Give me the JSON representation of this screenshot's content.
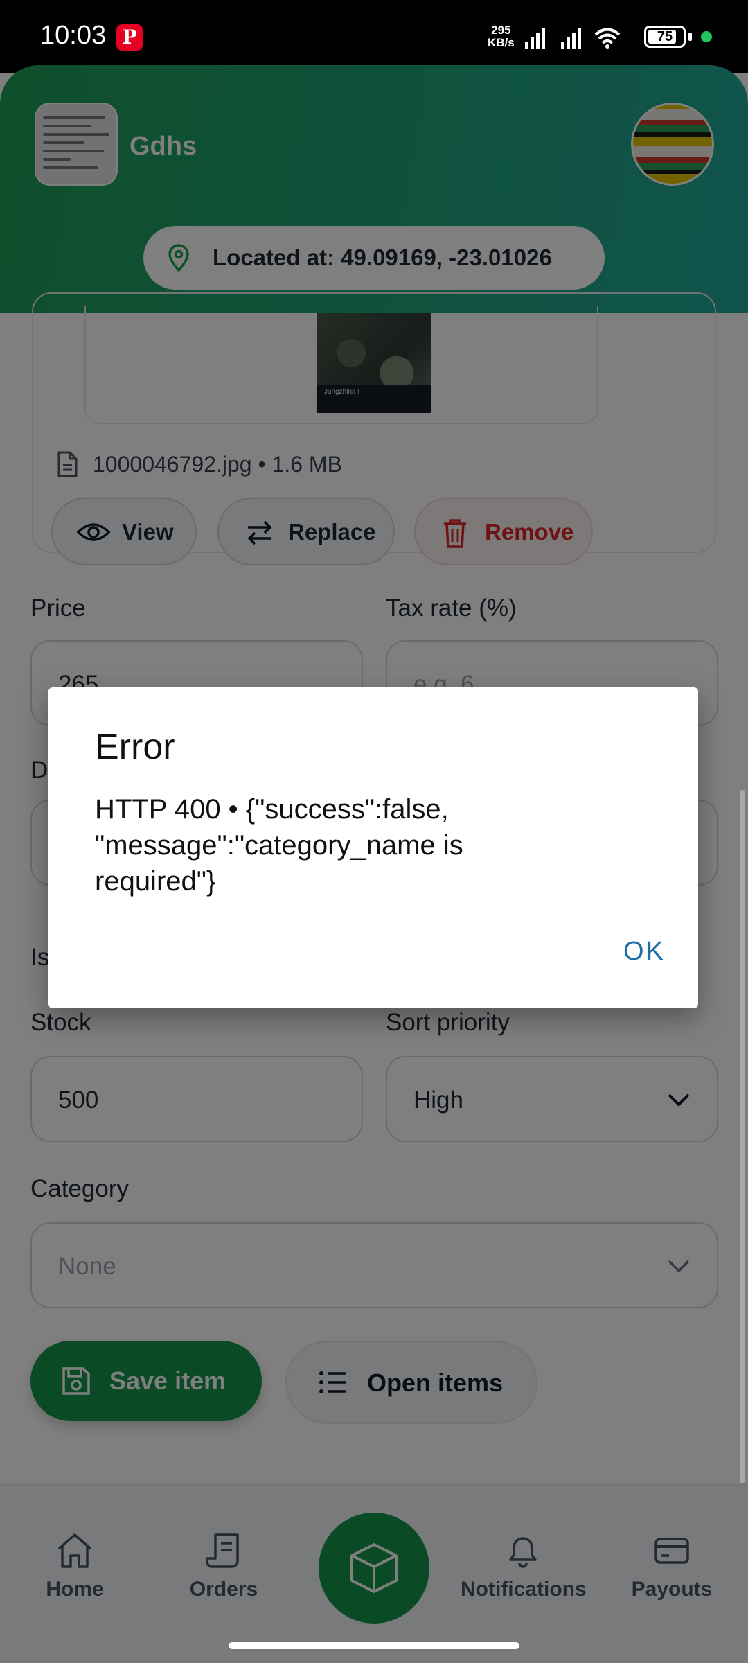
{
  "status_bar": {
    "time": "10:03",
    "pinterest_badge": "P",
    "net_speed_value": "295",
    "net_speed_unit": "KB/s",
    "battery": "75"
  },
  "header": {
    "store_name": "Gdhs",
    "location_text": "Located at: 49.09169, -23.01026"
  },
  "image_panel": {
    "map_caption": "Jungzhina I",
    "file_info": "1000046792.jpg • 1.6 MB",
    "view_label": "View",
    "replace_label": "Replace",
    "remove_label": "Remove"
  },
  "form": {
    "price_label": "Price",
    "price_value": "265",
    "tax_label": "Tax rate (%)",
    "tax_placeholder": "e.g. 6",
    "partial_label_d": "D",
    "partial_label_is": "Is",
    "stock_label": "Stock",
    "stock_value": "500",
    "sort_label": "Sort priority",
    "sort_value": "High",
    "category_label": "Category",
    "category_value": "None"
  },
  "actions": {
    "save_label": "Save item",
    "open_label": "Open items"
  },
  "bottom_nav": {
    "home": "Home",
    "orders": "Orders",
    "notifications": "Notifications",
    "payouts": "Payouts"
  },
  "dialog": {
    "title": "Error",
    "message": "HTTP 400 • {\"success\":false,\n\"message\":\"category_name is\nrequired\"}",
    "ok_label": "OK"
  },
  "colors": {
    "brand_green": "#14964a",
    "remove_red": "#dc2626",
    "dialog_button_blue": "#1d6fa5"
  }
}
